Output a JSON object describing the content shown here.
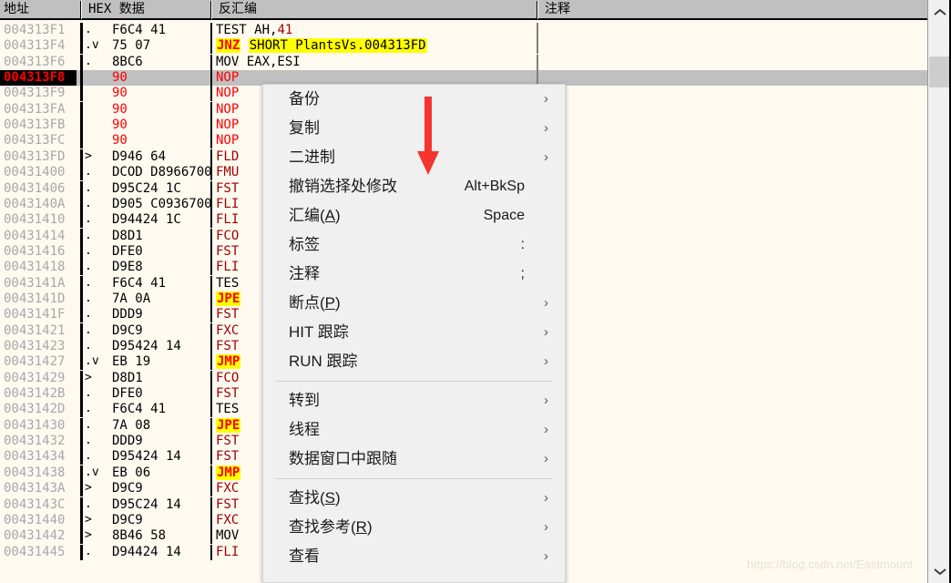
{
  "window": {
    "scrollbar": {
      "up_arrow": "chevron-up",
      "down_arrow": "chevron-down"
    }
  },
  "columns": [
    {
      "key": "address",
      "label": "地址"
    },
    {
      "key": "hex",
      "label": "HEX 数据"
    },
    {
      "key": "disassembly",
      "label": "反汇编"
    },
    {
      "key": "comment",
      "label": "注释"
    }
  ],
  "rows": [
    {
      "addr": "004313F1",
      "mark": ".",
      "hex": "F6C4 41",
      "hexred": false,
      "dis_pre": "TEST AH,",
      "dis_num": "41",
      "dis_style": "black",
      "selected": false
    },
    {
      "addr": "004313F4",
      "mark": ".v",
      "hex": "75 07",
      "hexred": false,
      "dis_jmp": "JNZ",
      "dis_tgt": "SHORT PlantsVs.004313FD",
      "dis_style": "jump",
      "selected": false
    },
    {
      "addr": "004313F6",
      "mark": ".",
      "hex": "8BC6",
      "hexred": false,
      "dis": "MOV EAX,ESI",
      "dis_style": "black",
      "selected": false
    },
    {
      "addr": "004313F8",
      "mark": "",
      "hex": "90",
      "hexred": true,
      "dis": "NOP",
      "dis_style": "nopred",
      "selected": true
    },
    {
      "addr": "004313F9",
      "mark": "",
      "hex": "90",
      "hexred": true,
      "dis": "NOP",
      "dis_style": "nopred",
      "selected": false
    },
    {
      "addr": "004313FA",
      "mark": "",
      "hex": "90",
      "hexred": true,
      "dis": "NOP",
      "dis_style": "nopred",
      "selected": false
    },
    {
      "addr": "004313FB",
      "mark": "",
      "hex": "90",
      "hexred": true,
      "dis": "NOP",
      "dis_style": "nopred",
      "selected": false
    },
    {
      "addr": "004313FC",
      "mark": "",
      "hex": "90",
      "hexred": true,
      "dis": "NOP",
      "dis_style": "nopred",
      "selected": false
    },
    {
      "addr": "004313FD",
      "mark": ">",
      "hex": "D946 64",
      "hexred": false,
      "dis": "FLD",
      "dis_style": "red",
      "selected": false
    },
    {
      "addr": "00431400",
      "mark": ".",
      "hex": "DCOD D8966700",
      "hexred": false,
      "dis": "FMU",
      "dis_style": "red",
      "selected": false
    },
    {
      "addr": "00431406",
      "mark": ".",
      "hex": "D95C24 1C",
      "hexred": false,
      "dis": "FST",
      "dis_style": "red",
      "selected": false
    },
    {
      "addr": "0043140A",
      "mark": ".",
      "hex": "D905 C0936700",
      "hexred": false,
      "dis": "FLI",
      "dis_style": "red",
      "selected": false
    },
    {
      "addr": "00431410",
      "mark": ".",
      "hex": "D94424 1C",
      "hexred": false,
      "dis": "FLI",
      "dis_style": "red",
      "selected": false
    },
    {
      "addr": "00431414",
      "mark": ".",
      "hex": "D8D1",
      "hexred": false,
      "dis": "FCO",
      "dis_style": "red",
      "selected": false
    },
    {
      "addr": "00431416",
      "mark": ".",
      "hex": "DFE0",
      "hexred": false,
      "dis": "FST",
      "dis_style": "red",
      "selected": false
    },
    {
      "addr": "00431418",
      "mark": ".",
      "hex": "D9E8",
      "hexred": false,
      "dis": "FLI",
      "dis_style": "red",
      "selected": false
    },
    {
      "addr": "0043141A",
      "mark": ".",
      "hex": "F6C4 41",
      "hexred": false,
      "dis": "TES",
      "dis_style": "black",
      "selected": false
    },
    {
      "addr": "0043141D",
      "mark": ".",
      "hex": "7A 0A",
      "hexred": false,
      "dis_jmp": "JPE",
      "dis_tgt": "",
      "dis_style": "jump",
      "selected": false
    },
    {
      "addr": "0043141F",
      "mark": ".",
      "hex": "DDD9",
      "hexred": false,
      "dis": "FST",
      "dis_style": "red",
      "selected": false
    },
    {
      "addr": "00431421",
      "mark": ".",
      "hex": "D9C9",
      "hexred": false,
      "dis": "FXC",
      "dis_style": "red",
      "selected": false
    },
    {
      "addr": "00431423",
      "mark": ".",
      "hex": "D95424 14",
      "hexred": false,
      "dis": "FST",
      "dis_style": "red",
      "selected": false
    },
    {
      "addr": "00431427",
      "mark": ".v",
      "hex": "EB 19",
      "hexred": false,
      "dis_jmp": "JMP",
      "dis_tgt": "",
      "dis_style": "jump",
      "selected": false
    },
    {
      "addr": "00431429",
      "mark": ">",
      "hex": "D8D1",
      "hexred": false,
      "dis": "FCO",
      "dis_style": "red",
      "selected": false
    },
    {
      "addr": "0043142B",
      "mark": ".",
      "hex": "DFE0",
      "hexred": false,
      "dis": "FST",
      "dis_style": "red",
      "selected": false
    },
    {
      "addr": "0043142D",
      "mark": ".",
      "hex": "F6C4 41",
      "hexred": false,
      "dis": "TES",
      "dis_style": "black",
      "selected": false
    },
    {
      "addr": "00431430",
      "mark": ".",
      "hex": "7A 08",
      "hexred": false,
      "dis_jmp": "JPE",
      "dis_tgt": "",
      "dis_style": "jump",
      "selected": false
    },
    {
      "addr": "00431432",
      "mark": ".",
      "hex": "DDD9",
      "hexred": false,
      "dis": "FST",
      "dis_style": "red",
      "selected": false
    },
    {
      "addr": "00431434",
      "mark": ".",
      "hex": "D95424 14",
      "hexred": false,
      "dis": "FST",
      "dis_style": "red",
      "selected": false
    },
    {
      "addr": "00431438",
      "mark": ".v",
      "hex": "EB 06",
      "hexred": false,
      "dis_jmp": "JMP",
      "dis_tgt": "",
      "dis_style": "jump",
      "selected": false
    },
    {
      "addr": "0043143A",
      "mark": ">",
      "hex": "D9C9",
      "hexred": false,
      "dis": "FXC",
      "dis_style": "red",
      "selected": false
    },
    {
      "addr": "0043143C",
      "mark": ".",
      "hex": "D95C24 14",
      "hexred": false,
      "dis": "FST",
      "dis_style": "red",
      "selected": false
    },
    {
      "addr": "00431440",
      "mark": ">",
      "hex": "D9C9",
      "hexred": false,
      "dis": "FXC",
      "dis_style": "red",
      "selected": false
    },
    {
      "addr": "00431442",
      "mark": ">",
      "hex": "8B46 58",
      "hexred": false,
      "dis": "MOV",
      "dis_style": "black",
      "selected": false
    },
    {
      "addr": "00431445",
      "mark": ".",
      "hex": "D94424 14",
      "hexred": false,
      "dis": "FLI",
      "dis_style": "red",
      "selected": false
    }
  ],
  "context_menu": {
    "items": [
      {
        "label": "备份",
        "accel": "",
        "submenu": true,
        "separator_after": false
      },
      {
        "label": "复制",
        "accel": "",
        "submenu": true,
        "separator_after": false
      },
      {
        "label": "二进制",
        "accel": "",
        "submenu": true,
        "separator_after": false
      },
      {
        "label": "撤销选择处修改",
        "accel": "Alt+BkSp",
        "submenu": false,
        "separator_after": false
      },
      {
        "label": "汇编(A)",
        "accel": "Space",
        "submenu": false,
        "separator_after": false,
        "underline": "A"
      },
      {
        "label": "标签",
        "accel": ":",
        "submenu": false,
        "separator_after": false
      },
      {
        "label": "注释",
        "accel": ";",
        "submenu": false,
        "separator_after": false
      },
      {
        "label": "断点(P)",
        "accel": "",
        "submenu": true,
        "separator_after": false,
        "underline": "P"
      },
      {
        "label": "HIT 跟踪",
        "accel": "",
        "submenu": true,
        "separator_after": false
      },
      {
        "label": "RUN 跟踪",
        "accel": "",
        "submenu": true,
        "separator_after": true
      },
      {
        "label": "转到",
        "accel": "",
        "submenu": true,
        "separator_after": false
      },
      {
        "label": "线程",
        "accel": "",
        "submenu": true,
        "separator_after": false
      },
      {
        "label": "数据窗口中跟随",
        "accel": "",
        "submenu": true,
        "separator_after": true
      },
      {
        "label": "查找(S)",
        "accel": "",
        "submenu": true,
        "separator_after": false,
        "underline": "S"
      },
      {
        "label": "查找参考(R)",
        "accel": "",
        "submenu": true,
        "separator_after": false,
        "underline": "R"
      },
      {
        "label": "查看",
        "accel": "",
        "submenu": true,
        "separator_after": false
      }
    ]
  },
  "annotation": {
    "arrow_color": "#f4352e"
  },
  "watermark": {
    "text": "https://blog.csdn.net/Eastmount"
  }
}
